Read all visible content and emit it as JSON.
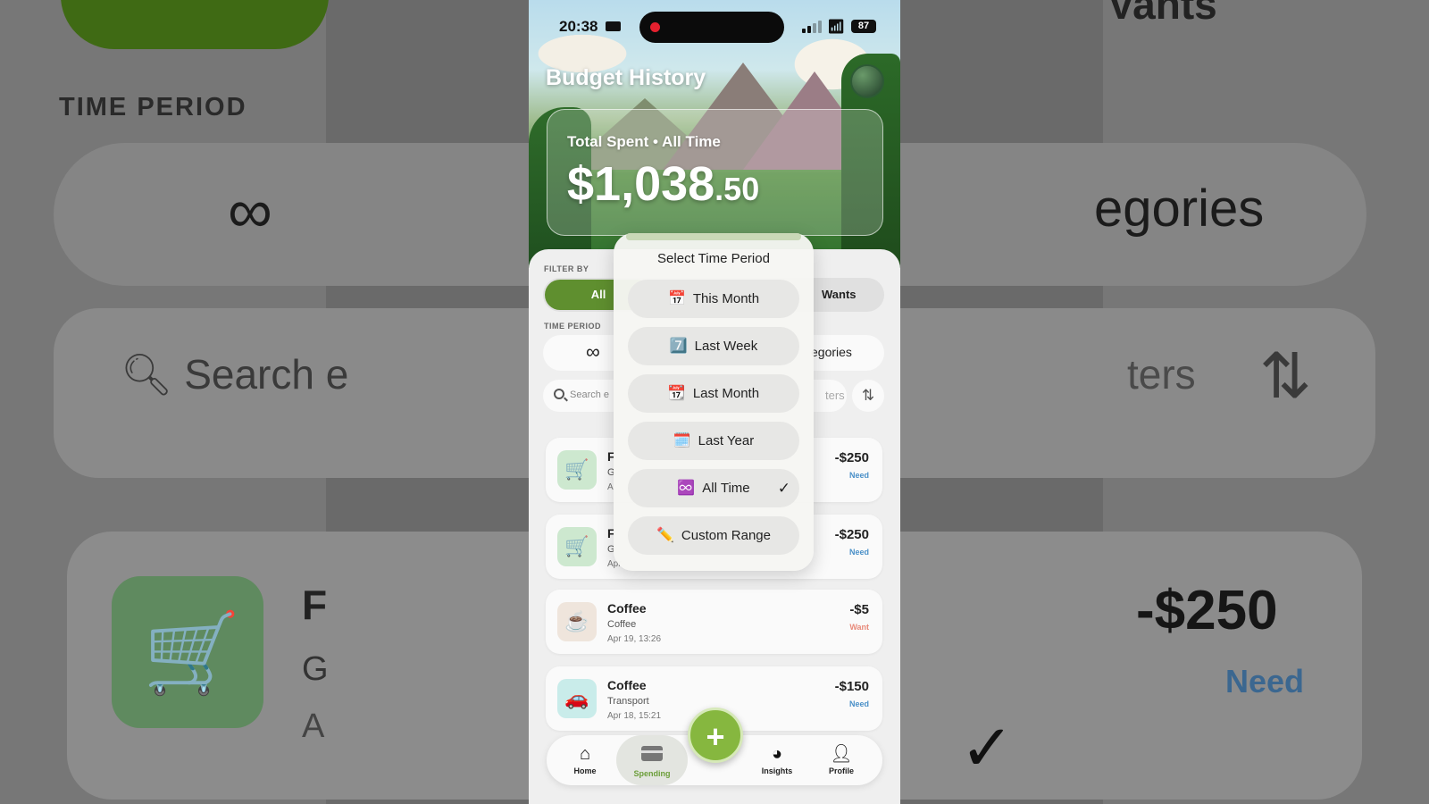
{
  "status_bar": {
    "time": "20:38",
    "battery": "87"
  },
  "header": {
    "title": "Budget History",
    "total_label": "Total Spent • All Time",
    "total_whole": "$1,038",
    "total_cents": ".50"
  },
  "filter": {
    "label": "FILTER BY",
    "all": "All",
    "wants": "Wants"
  },
  "time_period": {
    "label": "TIME PERIOD",
    "categories": "egories"
  },
  "search": {
    "placeholder": "Search e",
    "filters": "ters"
  },
  "dropdown": {
    "title": "Select Time Period",
    "items": [
      {
        "label": "This Month",
        "icon": "calendar-17-icon",
        "glyph": "📅",
        "selected": false
      },
      {
        "label": "Last Week",
        "icon": "seven-icon",
        "glyph": "7️⃣",
        "selected": false
      },
      {
        "label": "Last Month",
        "icon": "tear-off-calendar-icon",
        "glyph": "📆",
        "selected": false
      },
      {
        "label": "Last Year",
        "icon": "spiral-calendar-icon",
        "glyph": "🗓️",
        "selected": false
      },
      {
        "label": "All Time",
        "icon": "infinity-icon",
        "glyph": "♾️",
        "selected": true
      },
      {
        "label": "Custom Range",
        "icon": "pencil-icon",
        "glyph": "✏️",
        "selected": false
      }
    ],
    "check": "✓"
  },
  "transactions": [
    {
      "name": "F",
      "category": "G",
      "date": "A",
      "amount": "-$250",
      "tag": "Need",
      "icon": "shopping-cart-icon",
      "glyph": "🛒"
    },
    {
      "name": "F",
      "category": "G",
      "date": "Apr",
      "amount": "-$250",
      "tag": "Need",
      "icon": "shopping-cart-icon",
      "glyph": "🛒"
    },
    {
      "name": "Coffee",
      "category": "Coffee",
      "date": "Apr 19, 13:26",
      "amount": "-$5",
      "tag": "Want",
      "icon": "coffee-icon",
      "glyph": "☕"
    },
    {
      "name": "Coffee",
      "category": "Transport",
      "date": "Apr 18, 15:21",
      "amount": "-$150",
      "tag": "Need",
      "icon": "car-icon",
      "glyph": "🚗"
    }
  ],
  "nav": {
    "home": "Home",
    "spending": "Spending",
    "insights": "Insights",
    "profile": "Profile",
    "add": "+"
  },
  "background": {
    "time_period": "TIME PERIOD",
    "categories": "egories",
    "search": "Search e",
    "filters": "ters",
    "name": "F",
    "category": "G",
    "date": "A",
    "amount": "-$250",
    "tag": "Need",
    "wants": "Vants"
  },
  "colors": {
    "accent": "#5f8f2f",
    "need": "#4a90c8",
    "want": "#e88a7a",
    "fab": "#86b73f"
  }
}
